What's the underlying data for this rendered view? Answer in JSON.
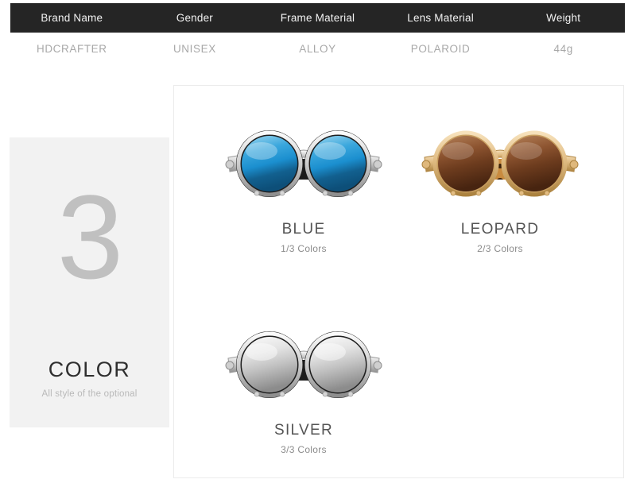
{
  "spec_table": {
    "headers": [
      "Brand Name",
      "Gender",
      "Frame Material",
      "Lens Material",
      "Weight"
    ],
    "values": [
      "HDCRAFTER",
      "UNISEX",
      "ALLOY",
      "POLAROID",
      "44g"
    ],
    "header_bg": "#252525",
    "header_text_color": "#f2f2f2",
    "value_text_color": "#a8a8a8"
  },
  "color_panel": {
    "count": "3",
    "title": "COLOR",
    "subtitle": "All style of the optional",
    "background": "#f2f2f2",
    "count_color": "#c0c0c0",
    "title_color": "#2f2f2f",
    "subtitle_color": "#b9b9b9"
  },
  "products": [
    {
      "name": "BLUE",
      "count_label": "1/3 Colors",
      "lens_color_top": "#9fd8ef",
      "lens_color_mid": "#1b8fcf",
      "lens_color_bottom": "#0d4f79",
      "frame_color": "#d8d8d8",
      "frame_color_dark": "#8e8e8e",
      "side_shield_color": "#1a1a1a"
    },
    {
      "name": "LEOPARD",
      "count_label": "2/3 Colors",
      "lens_color_top": "#a8714a",
      "lens_color_mid": "#7a4424",
      "lens_color_bottom": "#4b2512",
      "frame_color": "#e8c48f",
      "frame_color_dark": "#b98f4f",
      "side_shield_color": "#c98b3f"
    },
    {
      "name": "SILVER",
      "count_label": "3/3 Colors",
      "lens_color_top": "#f4f4f4",
      "lens_color_mid": "#cdcdcd",
      "lens_color_bottom": "#8f8f8f",
      "frame_color": "#dcdcdc",
      "frame_color_dark": "#8e8e8e",
      "side_shield_color": "#1a1a1a"
    }
  ]
}
